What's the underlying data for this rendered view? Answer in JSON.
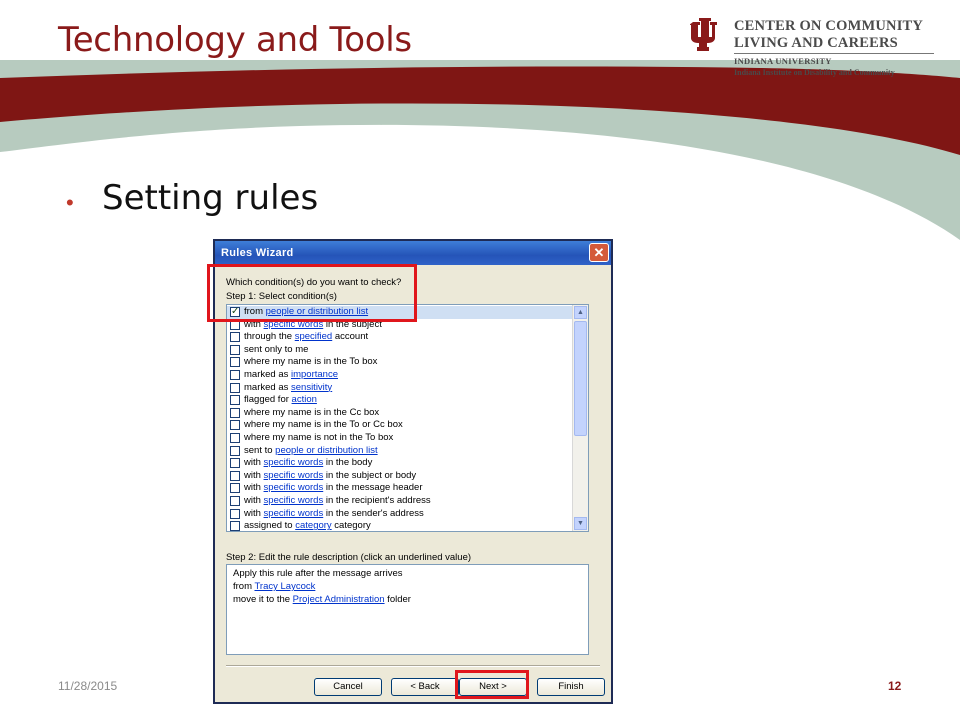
{
  "slide": {
    "title": "Technology and Tools",
    "bullet": "Setting rules",
    "footer_date": "11/28/2015",
    "page_number": "12",
    "colors": {
      "title": "#8a1a1a",
      "swoosh_primary": "#7f1614",
      "swoosh_secondary": "#b7cbbf",
      "bullet": "#c0392b",
      "highlight": "#e0161c"
    }
  },
  "logo": {
    "line1": "CENTER ON COMMUNITY",
    "line2": "LIVING AND CAREERS",
    "line3": "INDIANA UNIVERSITY",
    "line4": "Indiana Institute on Disability and Community",
    "icon": "iu-trident-icon"
  },
  "dialog": {
    "title": "Rules Wizard",
    "question": "Which condition(s) do you want to check?",
    "step1": "Step 1: Select condition(s)",
    "conditions": [
      {
        "pre": "from ",
        "link": "people or distribution list",
        "post": "",
        "checked": true
      },
      {
        "pre": "with ",
        "link": "specific words",
        "post": " in the subject",
        "checked": false
      },
      {
        "pre": "through the ",
        "link": "specified",
        "post": " account",
        "checked": false
      },
      {
        "pre": "sent only to me",
        "link": "",
        "post": "",
        "checked": false
      },
      {
        "pre": "where my name is in the To box",
        "link": "",
        "post": "",
        "checked": false
      },
      {
        "pre": "marked as ",
        "link": "importance",
        "post": "",
        "checked": false
      },
      {
        "pre": "marked as ",
        "link": "sensitivity",
        "post": "",
        "checked": false
      },
      {
        "pre": "flagged for ",
        "link": "action",
        "post": "",
        "checked": false
      },
      {
        "pre": "where my name is in the Cc box",
        "link": "",
        "post": "",
        "checked": false
      },
      {
        "pre": "where my name is in the To or Cc box",
        "link": "",
        "post": "",
        "checked": false
      },
      {
        "pre": "where my name is not in the To box",
        "link": "",
        "post": "",
        "checked": false
      },
      {
        "pre": "sent to ",
        "link": "people or distribution list",
        "post": "",
        "checked": false
      },
      {
        "pre": "with ",
        "link": "specific words",
        "post": " in the body",
        "checked": false
      },
      {
        "pre": "with ",
        "link": "specific words",
        "post": " in the subject or body",
        "checked": false
      },
      {
        "pre": "with ",
        "link": "specific words",
        "post": " in the message header",
        "checked": false
      },
      {
        "pre": "with ",
        "link": "specific words",
        "post": " in the recipient's address",
        "checked": false
      },
      {
        "pre": "with ",
        "link": "specific words",
        "post": " in the sender's address",
        "checked": false
      },
      {
        "pre": "assigned to ",
        "link": "category",
        "post": " category",
        "checked": false
      }
    ],
    "step2": "Step 2: Edit the rule description (click an underlined value)",
    "description": {
      "line1": "Apply this rule after the message arrives",
      "line2_pre": "from ",
      "line2_link": "Tracy Laycock",
      "line3_pre": "move it to the ",
      "line3_link": "Project Administration",
      "line3_post": " folder"
    },
    "buttons": {
      "cancel": "Cancel",
      "back": "< Back",
      "next": "Next >",
      "finish": "Finish"
    },
    "close_glyph": "✕",
    "check_glyph": "✓"
  }
}
